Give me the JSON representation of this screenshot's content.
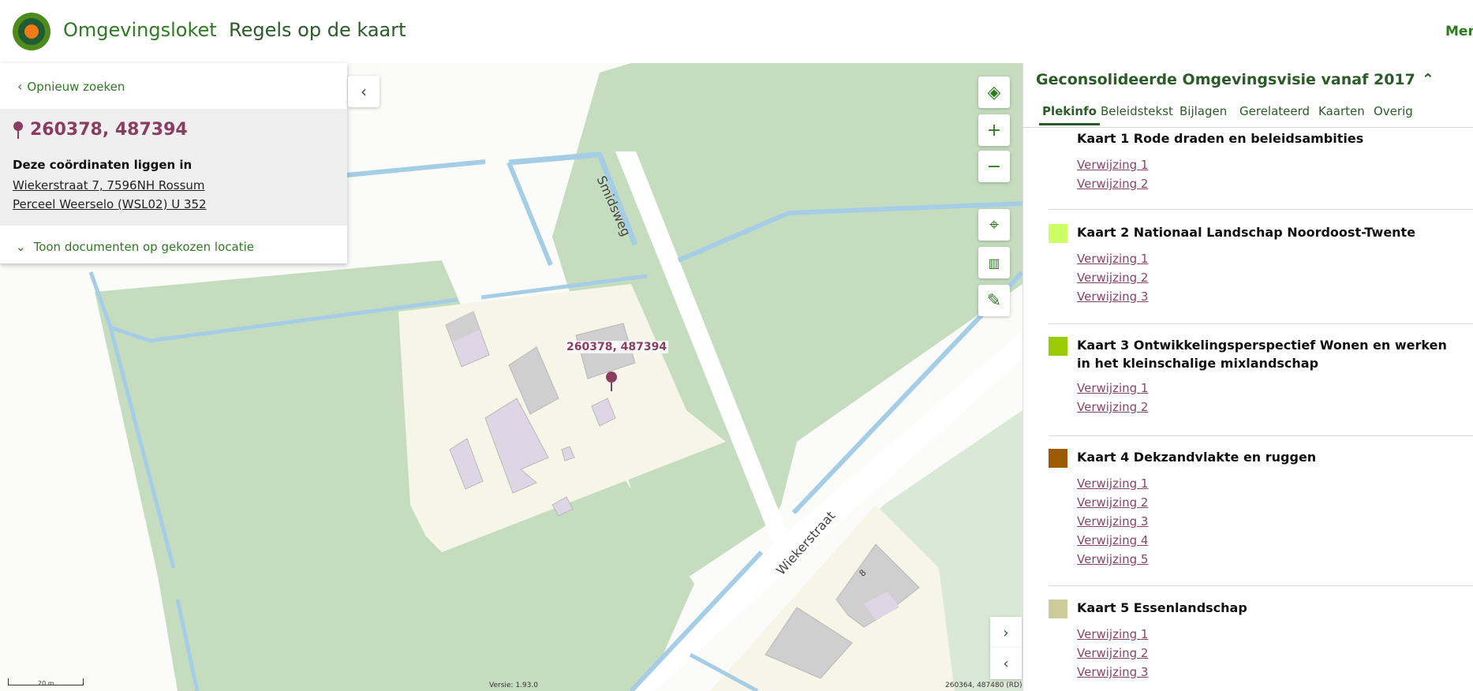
{
  "header": {
    "brand": "Omgevingsloket",
    "app_title": "Regels op de kaart",
    "menu_label": "Menu"
  },
  "search": {
    "back_label": "Opnieuw zoeken",
    "coordinates": "260378, 487394",
    "location_intro": "Deze coördinaten liggen in",
    "address": "Wiekerstraat 7, 7596NH Rossum",
    "parcel": "Perceel Weerselo (WSL02) U 352",
    "show_docs_label": "Toon documenten op gekozen locatie"
  },
  "map": {
    "marker_label": "260378, 487394",
    "streets": {
      "smidsweg": "Smidsweg",
      "wiekerstraat": "Wiekerstraat",
      "house_number": "8"
    },
    "scale_label": "20 m",
    "version": "Versie: 1.93.0",
    "coord_readout": "260364, 487480 (RD)",
    "colors": {
      "grass": "#c5ddbe",
      "water": "#a6cde6",
      "yard": "#f6f6e8",
      "building": "#cfcfcf",
      "building_lilac": "#ded6e4",
      "marker": "#8a3d5e"
    },
    "icons": [
      "layers-icon",
      "zoom-in-icon",
      "zoom-out-icon",
      "locate-icon",
      "measure-icon",
      "draw-icon"
    ]
  },
  "document": {
    "title": "Geconsolideerde Omgevingsvisie vanaf 2017",
    "tabs": [
      "Plekinfo",
      "Beleidstekst",
      "Bijlagen",
      "Gerelateerd",
      "Kaarten",
      "Overig"
    ],
    "active_tab": "Plekinfo",
    "kaarten": [
      {
        "title": "Kaart 1 Rode draden en beleidsambities",
        "color": "",
        "refs": [
          "Verwijzing 1",
          "Verwijzing 2"
        ]
      },
      {
        "title": "Kaart 2 Nationaal Landschap Noordoost-Twente",
        "color": "#ccff66",
        "refs": [
          "Verwijzing 1",
          "Verwijzing 2",
          "Verwijzing 3"
        ]
      },
      {
        "title": "Kaart 3 Ontwikkelingsperspectief Wonen en werken in het kleinschalige mixlandschap",
        "color": "#99cc00",
        "refs": [
          "Verwijzing 1",
          "Verwijzing 2"
        ]
      },
      {
        "title": "Kaart 4 Dekzandvlakte en ruggen",
        "color": "#9c5b00",
        "refs": [
          "Verwijzing 1",
          "Verwijzing 2",
          "Verwijzing 3",
          "Verwijzing 4",
          "Verwijzing 5"
        ]
      },
      {
        "title": "Kaart 5 Essenlandschap",
        "color": "#cccc99",
        "refs": [
          "Verwijzing 1",
          "Verwijzing 2",
          "Verwijzing 3"
        ]
      }
    ]
  }
}
